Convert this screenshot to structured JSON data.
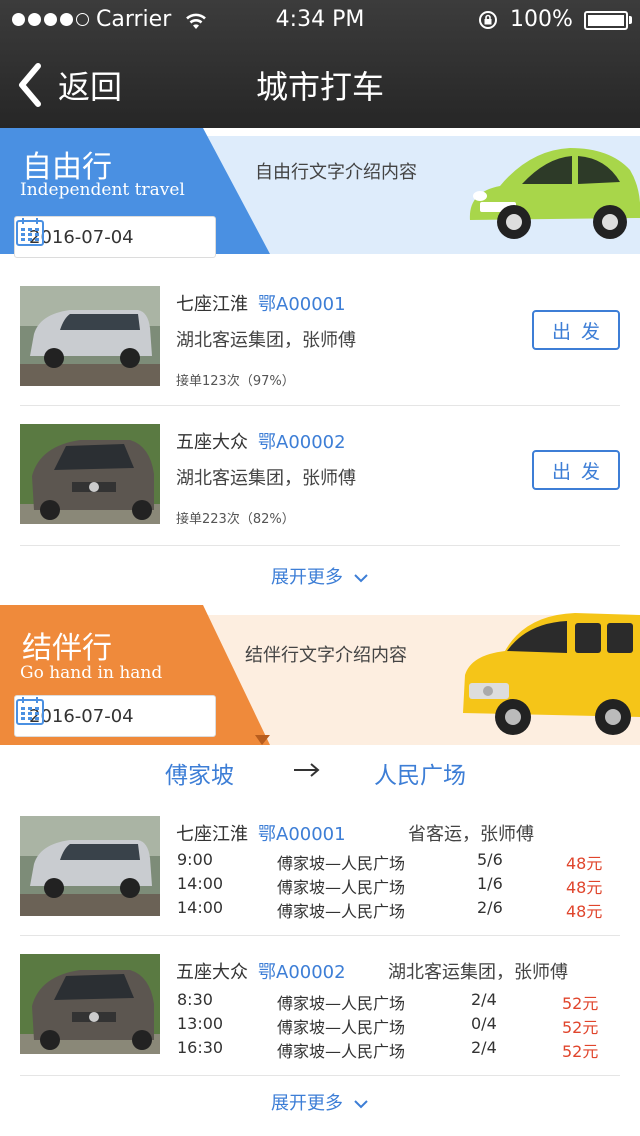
{
  "status_bar": {
    "carrier": "Carrier",
    "time": "4:34 PM",
    "battery": "100%"
  },
  "nav": {
    "back_label": "返回",
    "title": "城市打车"
  },
  "free_travel": {
    "title": "自由行",
    "subtitle": "Independent travel",
    "date": "2016-07-04",
    "intro": "自由行文字介绍内容",
    "color": "#4a90e2",
    "cars": [
      {
        "model": "七座江淮",
        "plate": "鄂A00001",
        "company": "湖北客运集团，张师傅",
        "stats": "接单123次（97%）",
        "button": "出发",
        "photo": "silver-minivan"
      },
      {
        "model": "五座大众",
        "plate": "鄂A00002",
        "company": "湖北客运集团，张师傅",
        "stats": "接单223次（82%）",
        "button": "出发",
        "photo": "grey-volkswagen"
      }
    ],
    "more_label": "展开更多"
  },
  "companion_travel": {
    "title": "结伴行",
    "subtitle": "Go hand in hand",
    "date": "2016-07-04",
    "intro": "结伴行文字介绍内容",
    "color": "#ef8a3b",
    "route": {
      "from": "傅家坡",
      "to": "人民广场"
    },
    "cars": [
      {
        "model": "七座江淮",
        "plate": "鄂A00001",
        "company": "省客运，张师傅",
        "photo": "silver-minivan",
        "trips": [
          {
            "time": "9:00",
            "route": "傅家坡—人民广场",
            "seats": "5/6",
            "price": "48元"
          },
          {
            "time": "14:00",
            "route": "傅家坡—人民广场",
            "seats": "1/6",
            "price": "48元"
          },
          {
            "time": "14:00",
            "route": "傅家坡—人民广场",
            "seats": "2/6",
            "price": "48元"
          }
        ]
      },
      {
        "model": "五座大众",
        "plate": "鄂A00002",
        "company": "湖北客运集团，张师傅",
        "photo": "grey-volkswagen",
        "trips": [
          {
            "time": "8:30",
            "route": "傅家坡—人民广场",
            "seats": "2/4",
            "price": "52元"
          },
          {
            "time": "13:00",
            "route": "傅家坡—人民广场",
            "seats": "0/4",
            "price": "52元"
          },
          {
            "time": "16:30",
            "route": "傅家坡—人民广场",
            "seats": "2/4",
            "price": "52元"
          }
        ]
      }
    ],
    "more_label": "展开更多"
  },
  "colors": {
    "accent_blue": "#3d7ed6",
    "price_red": "#e0452c",
    "nav_bg": "#2f2f2f"
  }
}
